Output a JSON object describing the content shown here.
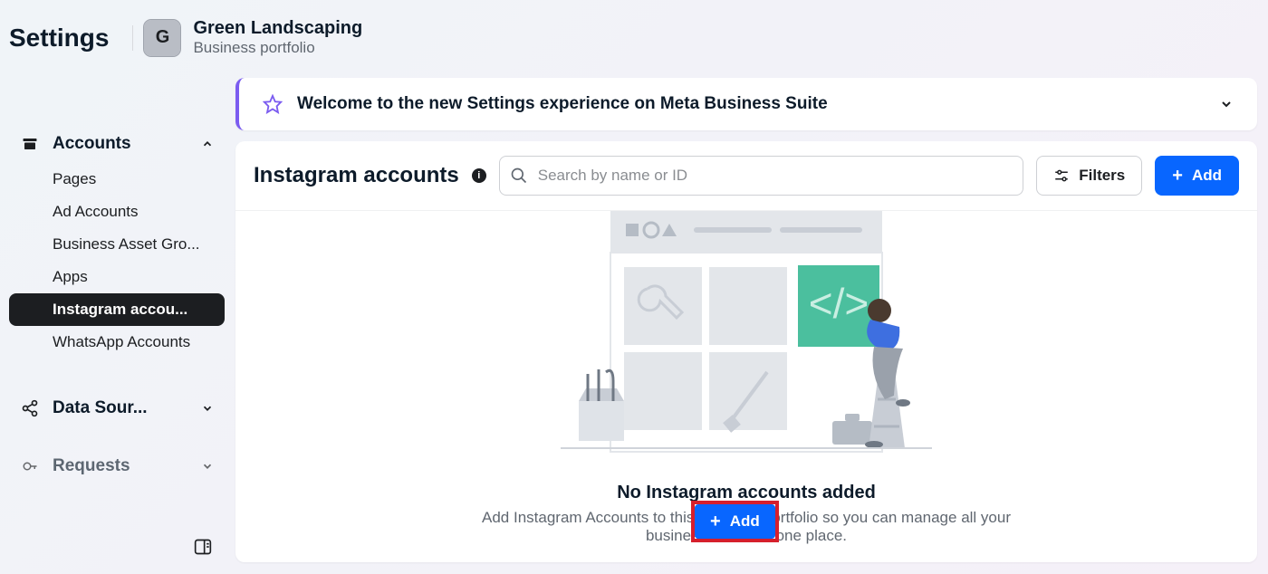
{
  "header": {
    "title": "Settings",
    "portfolio": {
      "badge": "G",
      "name": "Green Landscaping",
      "subtitle": "Business portfolio"
    }
  },
  "sidebar": {
    "sections": [
      {
        "label": "Accounts",
        "expanded": true,
        "items": [
          {
            "label": "Pages"
          },
          {
            "label": "Ad Accounts"
          },
          {
            "label": "Business Asset Gro..."
          },
          {
            "label": "Apps"
          },
          {
            "label": "Instagram accou...",
            "active": true
          },
          {
            "label": "WhatsApp Accounts"
          }
        ]
      },
      {
        "label": "Data Sour...",
        "expanded": false,
        "items": []
      },
      {
        "label": "Requests",
        "expanded": false,
        "items": []
      }
    ]
  },
  "banner": {
    "text": "Welcome to the new Settings experience on Meta Business Suite"
  },
  "panel": {
    "title": "Instagram accounts",
    "search_placeholder": "Search by name or ID",
    "filters_label": "Filters",
    "add_label": "Add"
  },
  "empty": {
    "title": "No Instagram accounts added",
    "subtitle": "Add Instagram Accounts to this business portfolio so you can manage all your business assets in one place."
  },
  "floating_add_label": "Add"
}
